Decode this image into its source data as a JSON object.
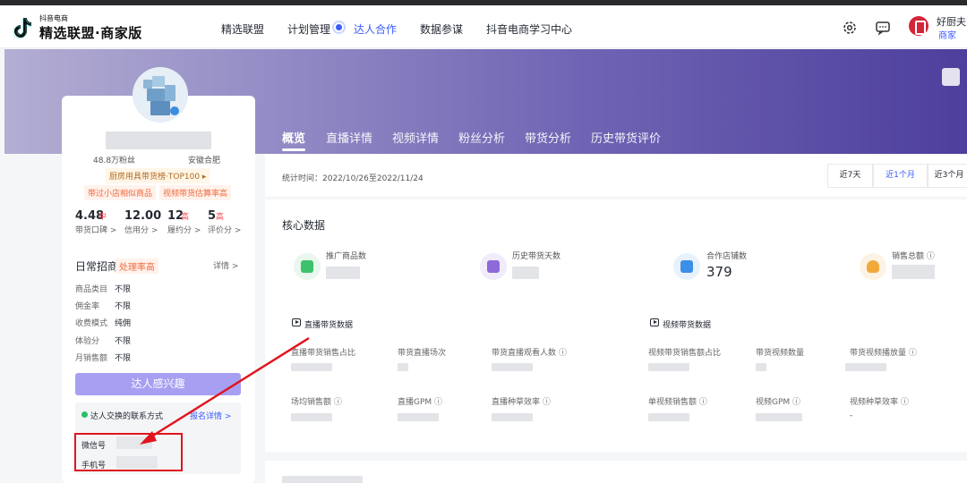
{
  "header": {
    "logo_small": "抖音电商",
    "logo_title": "精选联盟·商家版",
    "nav": [
      "精选联盟",
      "计划管理",
      "达人合作",
      "数据参谋",
      "抖音电商学习中心"
    ],
    "active_nav": "达人合作",
    "user_name": "好厨夫慧",
    "user_sub": "商家"
  },
  "profile": {
    "fans": "48.8万粉丝",
    "location": "安徽合肥",
    "rank_badge": "厨房用具带货榜·TOP100 ▸",
    "tags": [
      "带过小店相似商品",
      "视频带货估算率高"
    ],
    "scores": [
      {
        "value": "4.48",
        "level": "中",
        "label": "带货口碑 >"
      },
      {
        "value": "12.00",
        "level": "",
        "label": "信用分 >"
      },
      {
        "value": "12",
        "level": "高",
        "label": "履约分 >"
      },
      {
        "value": "5",
        "level": "高",
        "label": "评价分 >"
      }
    ],
    "daily_title": "日常招商",
    "daily_tag": "处理率高",
    "detail_link": "详情 >",
    "kv": [
      {
        "k": "商品类目",
        "v": "不限"
      },
      {
        "k": "佣金率",
        "v": "不限"
      },
      {
        "k": "收费模式",
        "v": "纯佣"
      },
      {
        "k": "体验分",
        "v": "不限"
      },
      {
        "k": "月销售额",
        "v": "不限"
      }
    ],
    "interest_button": "达人感兴趣",
    "contact_title": "达人交换的联系方式",
    "contact_link": "报名详情 >",
    "contact_wechat": "微信号",
    "contact_phone": "手机号"
  },
  "tabs": [
    "概览",
    "直播详情",
    "视频详情",
    "粉丝分析",
    "带货分析",
    "历史带货评价"
  ],
  "stats_time": "统计时间：2022/10/26至2022/11/24",
  "ranges": [
    "近7天",
    "近1个月",
    "近3个月"
  ],
  "active_range": "近1个月",
  "core": {
    "title": "核心数据",
    "metrics": [
      {
        "label": "推广商品数",
        "value": ""
      },
      {
        "label": "历史带货天数",
        "value": ""
      },
      {
        "label": "合作店铺数",
        "value": "379"
      },
      {
        "label": "销售总额 ⓘ",
        "value": ""
      }
    ],
    "live_title": "直播带货数据",
    "video_title": "视频带货数据",
    "live_cells": [
      "直播带货销售占比",
      "带货直播场次",
      "带货直播观看人数 ⓘ",
      "场均销售额 ⓘ",
      "直播GPM ⓘ",
      "直播种草效率 ⓘ"
    ],
    "video_cells": [
      "视频带货销售额占比",
      "带货视频数量",
      "带货视频播放量 ⓘ",
      "单视频销售额 ⓘ",
      "视频GPM ⓘ",
      "视频种草效率 ⓘ"
    ],
    "video_last_value": "-"
  },
  "colors": {
    "accent": "#3a5bff",
    "banner": "#6f64b4",
    "annotation": "#e0151f",
    "button": "#a7a0f2"
  }
}
